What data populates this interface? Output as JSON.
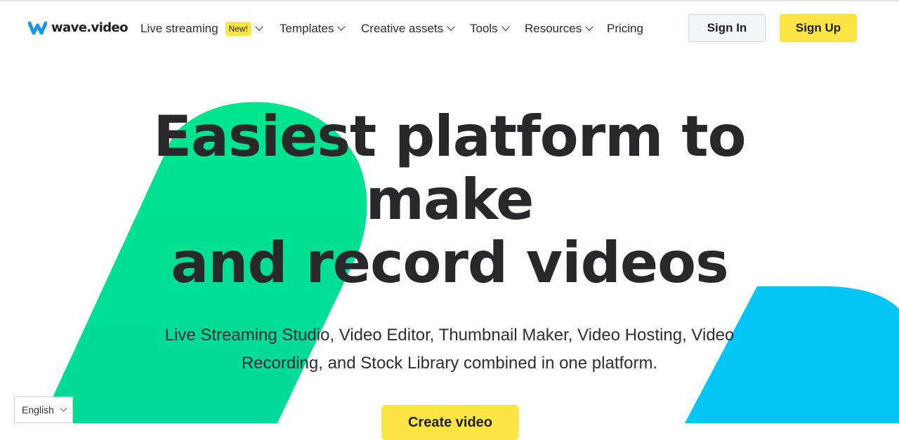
{
  "header": {
    "logo_text": "wave.video",
    "nav": [
      {
        "label": "Live streaming",
        "badge": "New!"
      },
      {
        "label": "Templates"
      },
      {
        "label": "Creative assets"
      },
      {
        "label": "Tools"
      },
      {
        "label": "Resources"
      },
      {
        "label": "Pricing"
      }
    ],
    "sign_in": "Sign In",
    "sign_up": "Sign Up"
  },
  "hero": {
    "title_line1": "Easiest platform to",
    "title_line2": "make",
    "title_line3": "and record videos",
    "subtitle": "Live Streaming Studio, Video Editor, Thumbnail Maker, Video Hosting, Video Recording, and Stock Library combined in one platform.",
    "cta": "Create video"
  },
  "language_selector": {
    "value": "English"
  },
  "colors": {
    "brand_blue": "#1896e8",
    "accent_yellow": "#fde545",
    "shape_green": "#00e58e",
    "shape_blue": "#00c6f5",
    "text_dark": "#28282b"
  }
}
